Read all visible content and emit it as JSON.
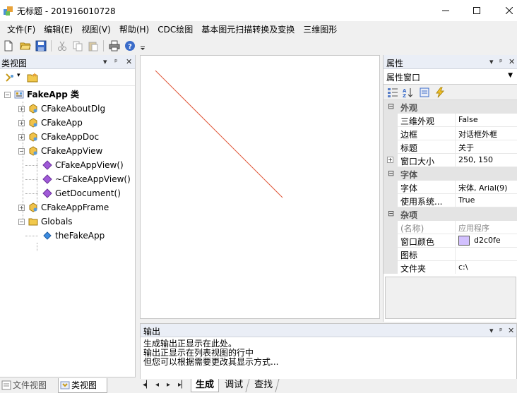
{
  "window": {
    "title": "无标题 - 201916010728",
    "min_icon": "minimize-icon",
    "max_icon": "maximize-icon",
    "close_icon": "close-icon"
  },
  "menu": [
    {
      "label": "文件(F)"
    },
    {
      "label": "编辑(E)"
    },
    {
      "label": "视图(V)"
    },
    {
      "label": "帮助(H)"
    },
    {
      "label": "CDC绘图"
    },
    {
      "label": "基本图元扫描转换及变换"
    },
    {
      "label": "三维图形"
    }
  ],
  "toolbar": {
    "icons": [
      "new-icon",
      "open-icon",
      "save-icon",
      "cut-icon",
      "copy-icon",
      "paste-icon",
      "print-icon",
      "help-icon",
      "overflow-icon"
    ]
  },
  "class_view": {
    "title": "类视图",
    "tree": [
      {
        "label": "FakeApp 类",
        "icon": "project-icon",
        "depth": 0,
        "expander": "minus",
        "bold": true
      },
      {
        "label": "CFakeAboutDlg",
        "icon": "class-icon",
        "depth": 1,
        "expander": "plus"
      },
      {
        "label": "CFakeApp",
        "icon": "class-icon",
        "depth": 1,
        "expander": "plus"
      },
      {
        "label": "CFakeAppDoc",
        "icon": "class-icon",
        "depth": 1,
        "expander": "plus"
      },
      {
        "label": "CFakeAppView",
        "icon": "class-icon",
        "depth": 1,
        "expander": "minus"
      },
      {
        "label": "CFakeAppView()",
        "icon": "method-icon",
        "depth": 2,
        "expander": "none"
      },
      {
        "label": "~CFakeAppView()",
        "icon": "method-icon",
        "depth": 2,
        "expander": "none"
      },
      {
        "label": "GetDocument()",
        "icon": "method-icon",
        "depth": 2,
        "expander": "none"
      },
      {
        "label": "CFakeAppFrame",
        "icon": "class-icon",
        "depth": 1,
        "expander": "plus"
      },
      {
        "label": "Globals",
        "icon": "folder-icon",
        "depth": 1,
        "expander": "minus"
      },
      {
        "label": "theFakeApp",
        "icon": "variable-icon",
        "depth": 2,
        "expander": "none"
      }
    ],
    "tabs": [
      {
        "label": "文件视图",
        "icon": "file-view-icon"
      },
      {
        "label": "类视图",
        "icon": "class-view-icon"
      }
    ]
  },
  "properties": {
    "title": "属性",
    "combo_value": "属性窗口",
    "categories": [
      {
        "label": "外观",
        "rows": [
          {
            "name": "三维外观",
            "value": "False"
          },
          {
            "name": "边框",
            "value": "对话框外框"
          },
          {
            "name": "标题",
            "value": "关于"
          },
          {
            "name": "窗口大小",
            "value": "250, 150",
            "expandable": true
          }
        ]
      },
      {
        "label": "字体",
        "rows": [
          {
            "name": "字体",
            "value": "宋体, Arial(9)"
          },
          {
            "name": "使用系统...",
            "value": "True"
          }
        ]
      },
      {
        "label": "杂项",
        "rows": [
          {
            "name": "(名称)",
            "value": "应用程序",
            "disabled": true
          },
          {
            "name": "窗口颜色",
            "value": "d2c0fe",
            "swatch": "#d2c0fe"
          },
          {
            "name": "图标",
            "value": ""
          },
          {
            "name": "文件夹",
            "value": "c:\\"
          }
        ]
      }
    ]
  },
  "output": {
    "title": "输出",
    "lines": [
      "生成输出正显示在此处。",
      "输出正显示在列表视图的行中",
      "但您可以根据需要更改其显示方式..."
    ],
    "tabs": [
      {
        "label": "生成"
      },
      {
        "label": "调试"
      },
      {
        "label": "查找"
      }
    ]
  },
  "colors": {
    "line": "#e0573a",
    "pane_header": "#eaeef6"
  }
}
